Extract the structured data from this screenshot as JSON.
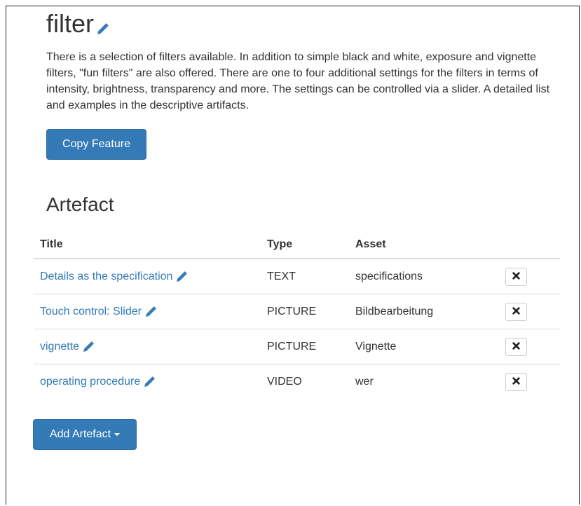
{
  "feature": {
    "title": "filter",
    "edit_icon": "pencil-icon",
    "description": "There is a selection of filters available. In addition to simple black and white, exposure and vignette filters, \"fun filters\" are also offered. There are one to four additional settings for the filters in terms of intensity, brightness, transparency and more. The settings can be controlled via a slider. A detailed list and examples in the descriptive artifacts.",
    "copy_button_label": "Copy Feature"
  },
  "artefacts": {
    "section_title": "Artefact",
    "columns": {
      "title": "Title",
      "type": "Type",
      "asset": "Asset"
    },
    "rows": [
      {
        "title": "Details as the specification",
        "type": "TEXT",
        "asset": "specifications"
      },
      {
        "title": "Touch control: Slider",
        "type": "PICTURE",
        "asset": "Bildbearbeitung"
      },
      {
        "title": "vignette",
        "type": "PICTURE",
        "asset": "Vignette"
      },
      {
        "title": "operating procedure",
        "type": "VIDEO",
        "asset": "wer"
      }
    ],
    "remove_icon": "close-icon",
    "add_button_label": "Add Artefact"
  },
  "colors": {
    "primary": "#337ab7",
    "text": "#333333",
    "border": "#dddddd"
  }
}
